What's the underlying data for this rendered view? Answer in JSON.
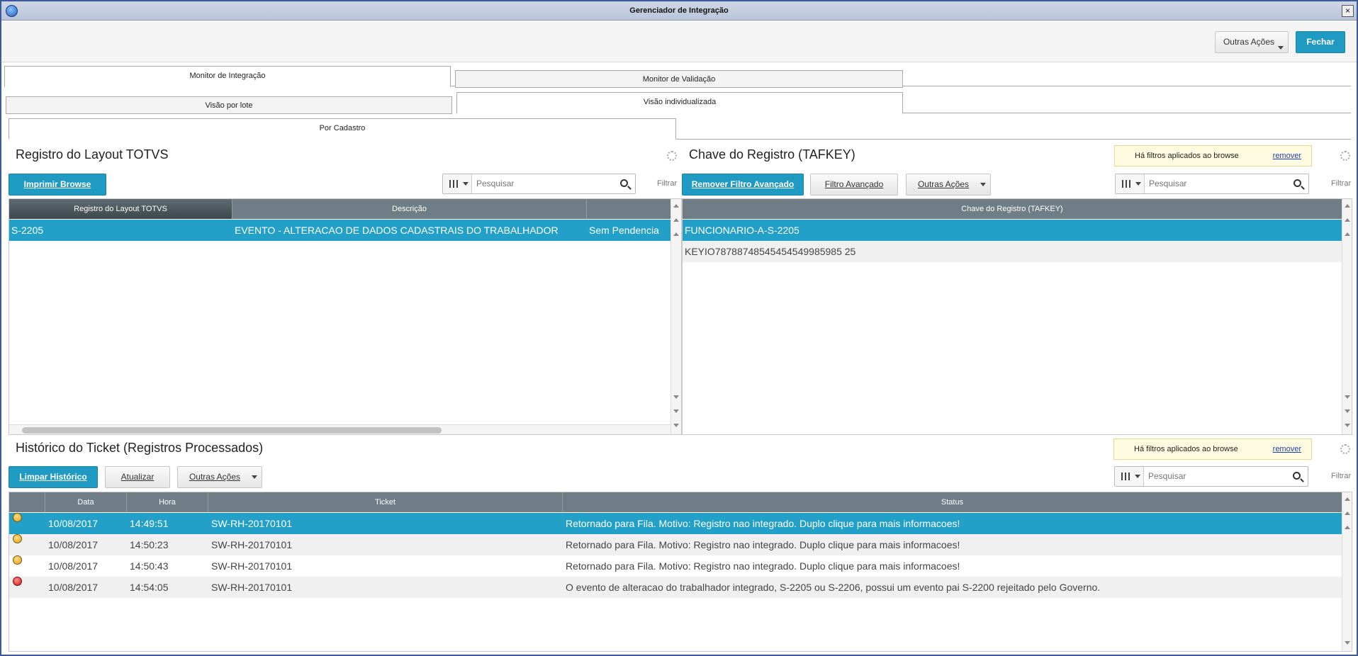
{
  "window": {
    "title": "Gerenciador de Integração",
    "close_glyph": "×"
  },
  "toolbar": {
    "outras_acoes": "Outras Ações",
    "fechar": "Fechar"
  },
  "tabs_level1": [
    {
      "label": "Monitor de Integração",
      "active": true
    },
    {
      "label": "Monitor de Validação",
      "active": false
    }
  ],
  "tabs_level2": [
    {
      "label": "Visão por lote",
      "active": false
    },
    {
      "label": "Visão individualizada",
      "active": true
    }
  ],
  "tabs_level3": [
    {
      "label": "Por Cadastro",
      "active": true
    }
  ],
  "left_panel": {
    "title": "Registro do Layout TOTVS",
    "print_button": "Imprimir Browse",
    "search_placeholder": "Pesquisar",
    "filtrar": "Filtrar",
    "columns": [
      "Registro do Layout TOTVS",
      "Descrição",
      ""
    ],
    "rows": [
      {
        "registro": "S-2205",
        "descricao": "EVENTO - ALTERACAO DE DADOS CADASTRAIS DO TRABALHADOR",
        "status": "Sem Pendencia",
        "selected": true
      }
    ]
  },
  "right_panel": {
    "title": "Chave do Registro (TAFKEY)",
    "filter_notice": "Há filtros aplicados ao browse",
    "remove_link": "remover",
    "remove_filter_button": "Remover Filtro Avançado",
    "advanced_filter_button": "Filtro Avançado",
    "other_actions_button": "Outras Ações",
    "search_placeholder": "Pesquisar",
    "filtrar": "Filtrar",
    "columns": [
      "Chave do Registro (TAFKEY)"
    ],
    "rows": [
      {
        "chave": "FUNCIONARIO-A-S-2205",
        "selected": true
      },
      {
        "chave": "KEYIO78788748545454549985985 25",
        "selected": false
      }
    ]
  },
  "bottom_panel": {
    "title": "Histórico do Ticket (Registros Processados)",
    "filter_notice": "Há filtros aplicados ao browse",
    "remove_link": "remover",
    "clear_button": "Limpar Histórico",
    "refresh_button": "Atualizar",
    "other_actions_button": "Outras Ações",
    "search_placeholder": "Pesquisar",
    "filtrar": "Filtrar",
    "columns": [
      "",
      "Data",
      "Hora",
      "Ticket",
      "Status"
    ],
    "rows": [
      {
        "indicator": "orange",
        "data": "10/08/2017",
        "hora": "14:49:51",
        "ticket": "SW-RH-20170101",
        "status": "Retornado para Fila. Motivo: Registro nao integrado. Duplo clique para mais informacoes!",
        "selected": true
      },
      {
        "indicator": "orange",
        "data": "10/08/2017",
        "hora": "14:50:23",
        "ticket": "SW-RH-20170101",
        "status": "Retornado para Fila. Motivo: Registro nao integrado. Duplo clique para mais informacoes!",
        "selected": false
      },
      {
        "indicator": "orange",
        "data": "10/08/2017",
        "hora": "14:50:43",
        "ticket": "SW-RH-20170101",
        "status": "Retornado para Fila. Motivo: Registro nao integrado. Duplo clique para mais informacoes!",
        "selected": false
      },
      {
        "indicator": "red",
        "data": "10/08/2017",
        "hora": "14:54:05",
        "ticket": "SW-RH-20170101",
        "status": "O evento de alteracao do trabalhador integrado, S-2205 ou S-2206, possui um evento pai S-2200 rejeitado pelo Governo.",
        "selected": false
      }
    ]
  },
  "colors": {
    "accent": "#1f9ac2",
    "selected_row": "#22a0c8",
    "grid_header": "#6f7d86",
    "filter_badge": "#fffbe0"
  }
}
